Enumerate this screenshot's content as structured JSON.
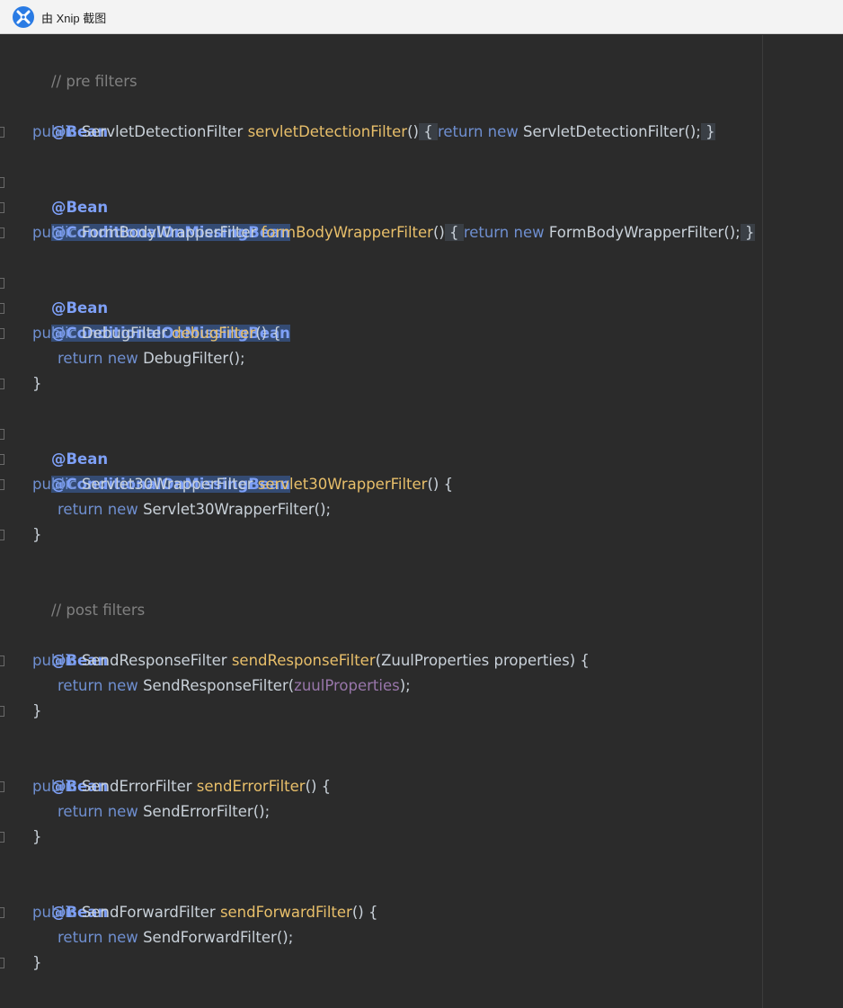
{
  "window": {
    "title": "由 Xnip 截图",
    "app_icon": "xnip-app-icon"
  },
  "code": {
    "comment_pre": "// pre filters",
    "comment_post": "// post filters",
    "bean": "@Bean",
    "conditional": "@ConditionalOnMissingBean",
    "kw_public": "public",
    "kw_return": "return",
    "kw_new": "new",
    "servlet_detection": {
      "type": "ServletDetectionFilter",
      "method": "servletDetectionFilter",
      "ctor": "ServletDetectionFilter"
    },
    "form_body": {
      "type": "FormBodyWrapperFilter",
      "method": "formBodyWrapperFilter",
      "ctor": "FormBodyWrapperFilter"
    },
    "debug": {
      "type": "DebugFilter",
      "method": "debugFilter",
      "ctor": "DebugFilter"
    },
    "servlet30": {
      "type": "Servlet30WrapperFilter",
      "method": "servlet30WrapperFilter",
      "ctor": "Servlet30WrapperFilter"
    },
    "send_response": {
      "type": "SendResponseFilter",
      "method": "sendResponseFilter",
      "param_type": "ZuulProperties",
      "param_name": "properties",
      "ctor": "SendResponseFilter",
      "arg": "zuulProperties"
    },
    "send_error": {
      "type": "SendErrorFilter",
      "method": "sendErrorFilter",
      "ctor": "SendErrorFilter"
    },
    "send_forward": {
      "type": "SendForwardFilter",
      "method": "sendForwardFilter",
      "ctor": "SendForwardFilter"
    },
    "colors": {
      "background": "#2b2b2b",
      "annotation": "#7ea0f7",
      "keyword": "#6f8fd0",
      "method": "#e8bf6a",
      "field": "#9876aa",
      "comment": "#808080"
    }
  }
}
